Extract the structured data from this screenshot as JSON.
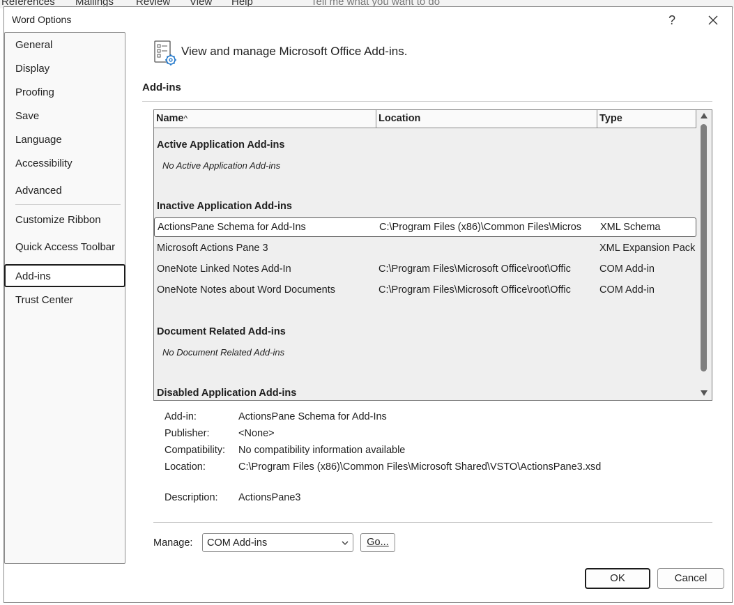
{
  "background": {
    "ribbon_tabs": [
      "References",
      "Mailings",
      "Review",
      "View",
      "Help"
    ],
    "tell_me": "Tell me what you want to do"
  },
  "dialog": {
    "title": "Word Options",
    "help_label": "?"
  },
  "nav": {
    "items": [
      {
        "label": "General"
      },
      {
        "label": "Display"
      },
      {
        "label": "Proofing"
      },
      {
        "label": "Save"
      },
      {
        "label": "Language"
      },
      {
        "label": "Accessibility"
      },
      {
        "label": "Advanced"
      },
      {
        "label": "Customize Ribbon"
      },
      {
        "label": "Quick Access Toolbar"
      },
      {
        "label": "Add-ins",
        "active": true
      },
      {
        "label": "Trust Center"
      }
    ]
  },
  "header": {
    "icon": "addins-settings-icon",
    "text": "View and manage Microsoft Office Add-ins."
  },
  "section": {
    "title": "Add-ins"
  },
  "grid": {
    "columns": [
      "Name",
      "Location",
      "Type"
    ],
    "sort_indicator": "^",
    "groups": {
      "active": {
        "title": "Active Application Add-ins",
        "empty": "No Active Application Add-ins"
      },
      "inactive": {
        "title": "Inactive Application Add-ins",
        "rows": [
          {
            "name": "ActionsPane Schema for Add-Ins",
            "location": "C:\\Program Files (x86)\\Common Files\\Micros",
            "type": "XML Schema",
            "selected": true
          },
          {
            "name": "Microsoft Actions Pane 3",
            "location": "",
            "type": "XML Expansion Pack"
          },
          {
            "name": "OneNote Linked Notes Add-In",
            "location": "C:\\Program Files\\Microsoft Office\\root\\Offic",
            "type": "COM Add-in"
          },
          {
            "name": "OneNote Notes about Word Documents",
            "location": "C:\\Program Files\\Microsoft Office\\root\\Offic",
            "type": "COM Add-in"
          }
        ]
      },
      "document": {
        "title": "Document Related Add-ins",
        "empty": "No Document Related Add-ins"
      },
      "disabled": {
        "title": "Disabled Application Add-ins"
      }
    }
  },
  "details": {
    "addin_label": "Add-in:",
    "addin_value": "ActionsPane Schema for Add-Ins",
    "publisher_label": "Publisher:",
    "publisher_value": "<None>",
    "compat_label": "Compatibility:",
    "compat_value": "No compatibility information available",
    "location_label": "Location:",
    "location_value": "C:\\Program Files (x86)\\Common Files\\Microsoft Shared\\VSTO\\ActionsPane3.xsd",
    "description_label": "Description:",
    "description_value": "ActionsPane3"
  },
  "manage": {
    "label": "Manage:",
    "selected": "COM Add-ins",
    "go_label": "Go..."
  },
  "buttons": {
    "ok": "OK",
    "cancel": "Cancel"
  }
}
